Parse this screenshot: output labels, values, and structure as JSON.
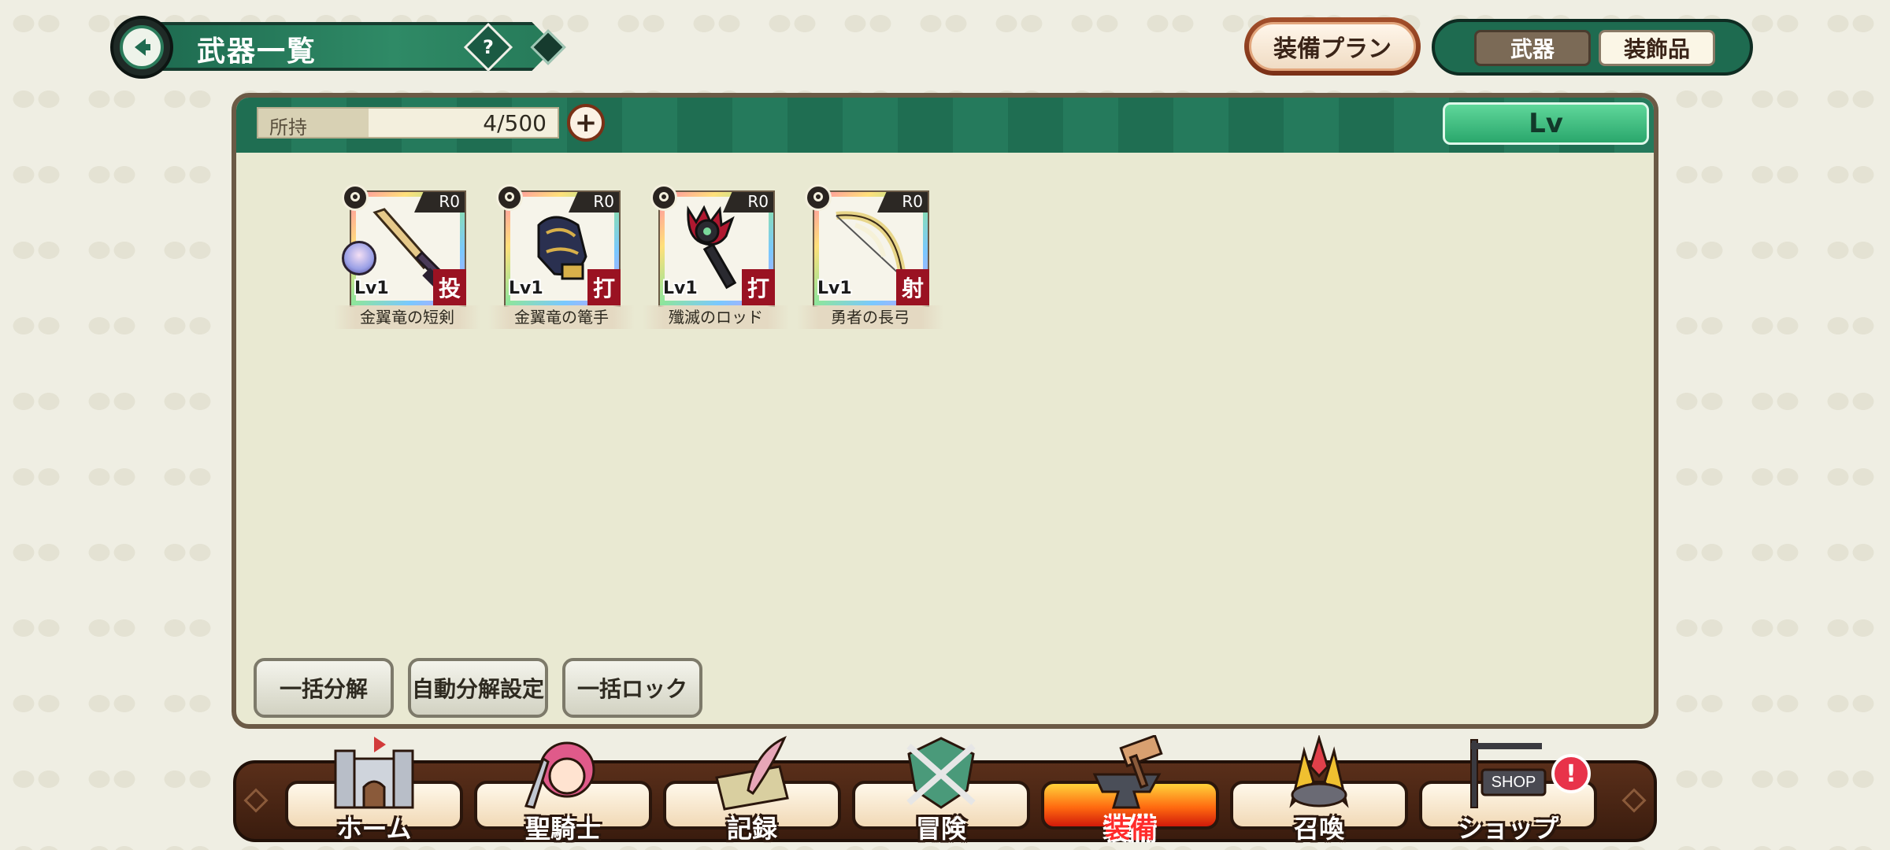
{
  "header": {
    "title": "武器一覧",
    "help_label": "?"
  },
  "top_buttons": {
    "plan_label": "装備プラン",
    "tabs": [
      {
        "label": "武器",
        "active": true
      },
      {
        "label": "装飾品",
        "active": false
      }
    ]
  },
  "inventory": {
    "owned_label": "所持",
    "owned_value": "4/500",
    "plus_label": "+",
    "sort_label": "Lv"
  },
  "weapons": [
    {
      "name": "金翼竜の短剣",
      "rank": "R0",
      "level": "Lv1",
      "type": "投",
      "icon": "dagger-icon",
      "equipped": true
    },
    {
      "name": "金翼竜の篭手",
      "rank": "R0",
      "level": "Lv1",
      "type": "打",
      "icon": "gauntlet-icon",
      "equipped": false
    },
    {
      "name": "殲滅のロッド",
      "rank": "R0",
      "level": "Lv1",
      "type": "打",
      "icon": "rod-icon",
      "equipped": false
    },
    {
      "name": "勇者の長弓",
      "rank": "R0",
      "level": "Lv1",
      "type": "射",
      "icon": "bow-icon",
      "equipped": false
    }
  ],
  "actions": {
    "bulk_dismantle": "一括分解",
    "auto_dismantle": "自動分解設定",
    "bulk_lock": "一括ロック"
  },
  "nav": {
    "items": [
      {
        "label": "ホーム",
        "icon": "castle-icon",
        "active": false
      },
      {
        "label": "聖騎士",
        "icon": "knight-character-icon",
        "active": false
      },
      {
        "label": "記録",
        "icon": "quill-book-icon",
        "active": false
      },
      {
        "label": "冒険",
        "icon": "crossed-swords-icon",
        "active": false
      },
      {
        "label": "装備",
        "icon": "anvil-hammer-icon",
        "active": true
      },
      {
        "label": "召喚",
        "icon": "crystal-icon",
        "active": false
      },
      {
        "label": "ショップ",
        "icon": "shop-sign-icon",
        "active": false,
        "alert": "!",
        "sign_text": "SHOP"
      }
    ]
  },
  "colors": {
    "header_green": "#1e6b50",
    "panel_bg": "#e9e9d2",
    "type_badge": "#9a1222",
    "active_nav": "#ff6a10"
  }
}
